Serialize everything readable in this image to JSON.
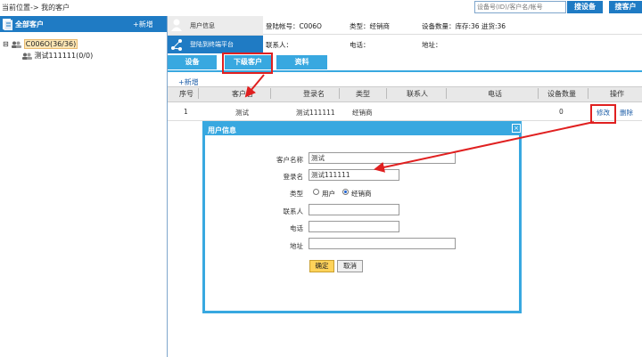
{
  "topbar": {
    "breadcrumb": "当前位置-> 我的客户",
    "search_placeholder": "设备号(ID)/客户名/帐号",
    "search_device_button": "搜设备",
    "search_customer_button": "搜客户"
  },
  "sidebar": {
    "title": "全部客户",
    "add_label": "+新增",
    "tree_root": "C006O(36/36)",
    "tree_toggle": "⊟",
    "tree_child": "测试111111(0/0)"
  },
  "header": {
    "tab_userinfo": "用户信息",
    "tab_platform": "登陆到终端平台",
    "login_account": "登陆帐号：C006O",
    "type": "类型：经销商",
    "device_count": "设备数量：库存:36 迸货:36",
    "contact": "联系人：",
    "phone": "电话：",
    "address": "地址："
  },
  "subtabs": [
    "设备",
    "下级客户",
    "资料"
  ],
  "add_new": "+新增",
  "table": {
    "columns": [
      "序号",
      "客户名",
      "登录名",
      "类型",
      "联系人",
      "电话",
      "设备数量",
      "操作"
    ],
    "rows": [
      {
        "index": "1",
        "name": "测试",
        "login": "测试111111",
        "type": "经销商",
        "contact": "",
        "phone": "",
        "devices": "0",
        "edit": "修改",
        "delete": "删除"
      }
    ]
  },
  "dialog": {
    "title": "用户信息",
    "close": "×",
    "fields": {
      "customer_name_label": "客户名称",
      "customer_name_value": "测试",
      "login_label": "登录名",
      "login_value": "测试111111",
      "type_label": "类型",
      "type_user": "用户",
      "type_dealer": "经销商",
      "contact_label": "联系人",
      "phone_label": "电话",
      "address_label": "地址"
    },
    "ok": "确定",
    "cancel": "取消"
  },
  "colors": {
    "primary": "#1f7bc4",
    "tab_blue": "#38a8e0",
    "highlight_red": "#e02020"
  }
}
